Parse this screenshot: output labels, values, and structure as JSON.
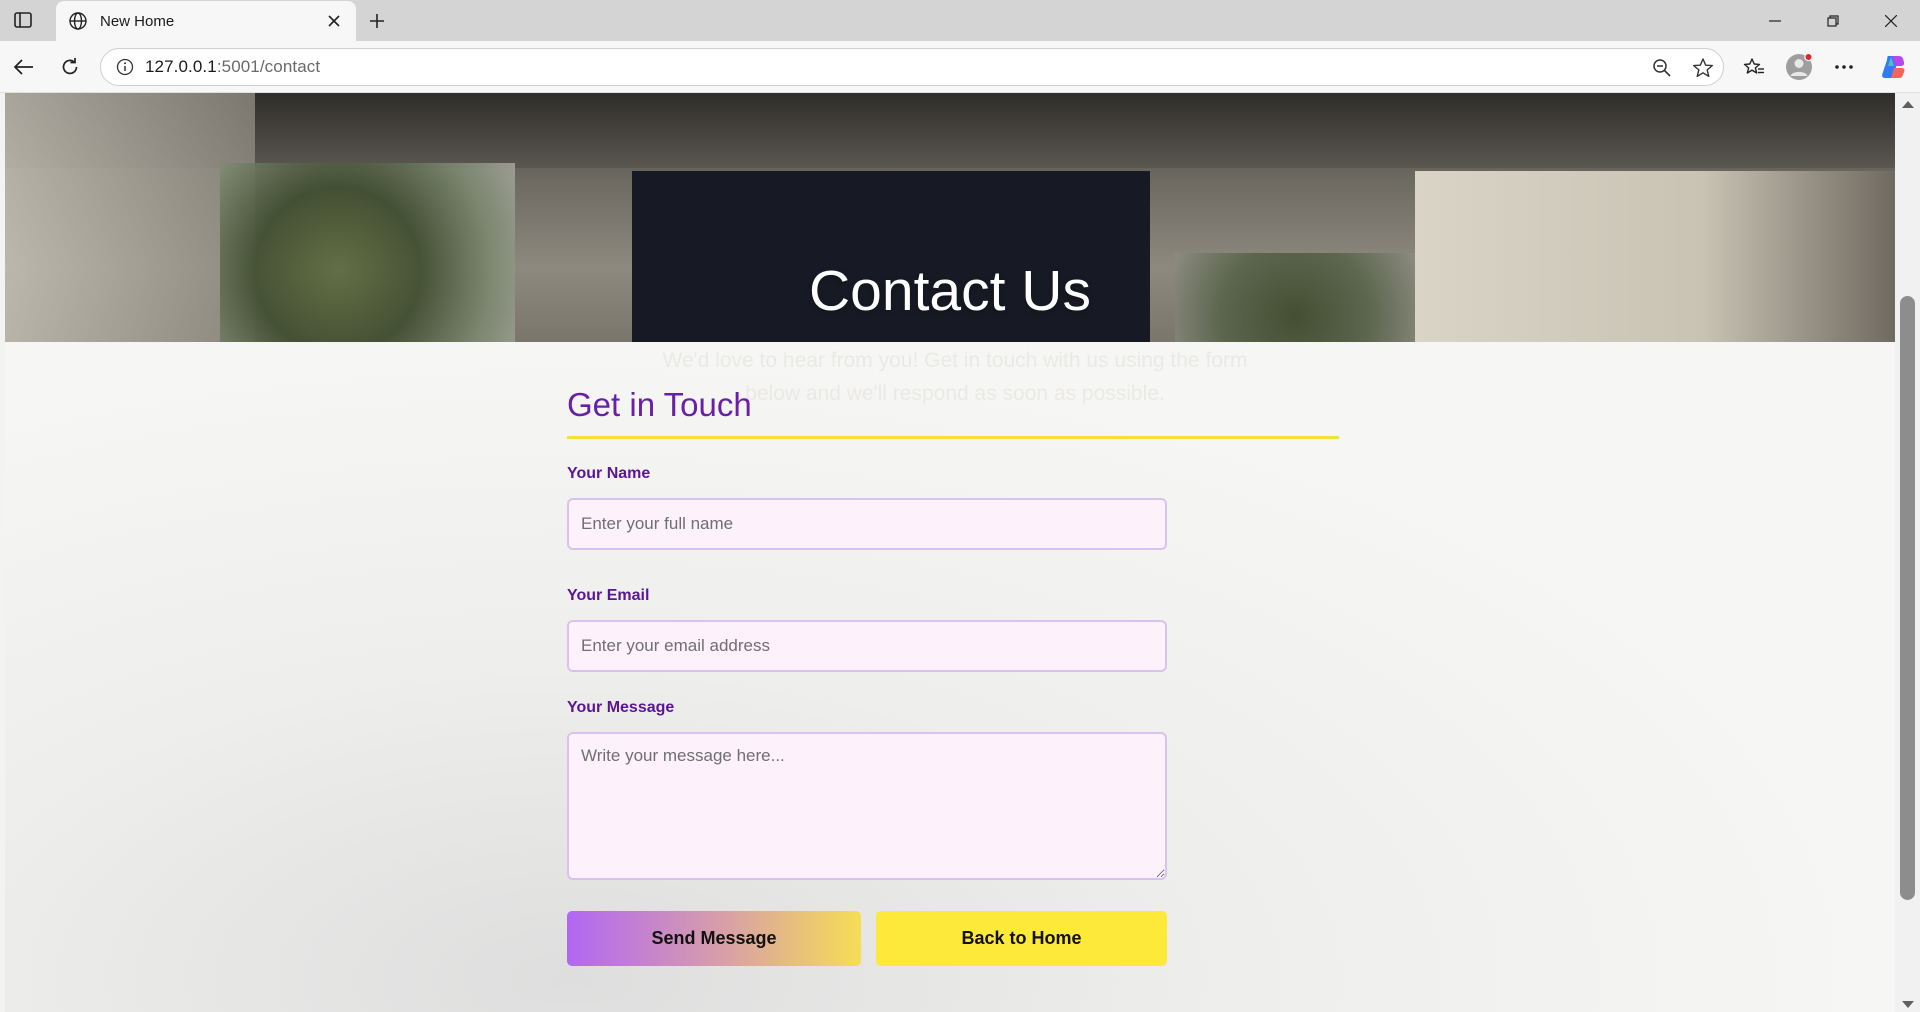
{
  "browser": {
    "tab_title": "New Home",
    "url_host": "127.0.0.1",
    "url_path": ":5001/contact",
    "icons": [
      "sidebar-toggle-icon",
      "globe-icon",
      "close-icon",
      "plus-icon",
      "minimize-icon",
      "restore-icon",
      "close-window-icon",
      "back-icon",
      "refresh-icon",
      "info-icon",
      "zoom-out-icon",
      "star-icon",
      "favorites-icon",
      "profile-icon",
      "more-icon",
      "copilot-icon"
    ]
  },
  "hero": {
    "title": "Contact Us",
    "subtitle": "We'd love to hear from you! Get in touch with us using the form below and we'll respond as soon as possible."
  },
  "form": {
    "heading": "Get in Touch",
    "name_label": "Your Name",
    "name_placeholder": "Enter your full name",
    "email_label": "Your Email",
    "email_placeholder": "Enter your email address",
    "message_label": "Your Message",
    "message_placeholder": "Write your message here...",
    "send_button": "Send Message",
    "home_button": "Back to Home"
  },
  "colors": {
    "accent_purple": "#6a1fa7",
    "label_purple": "#5b1596",
    "underline_yellow": "#f6de3c",
    "button_yellow": "#fde93a",
    "input_bg": "#fdf2fc"
  }
}
